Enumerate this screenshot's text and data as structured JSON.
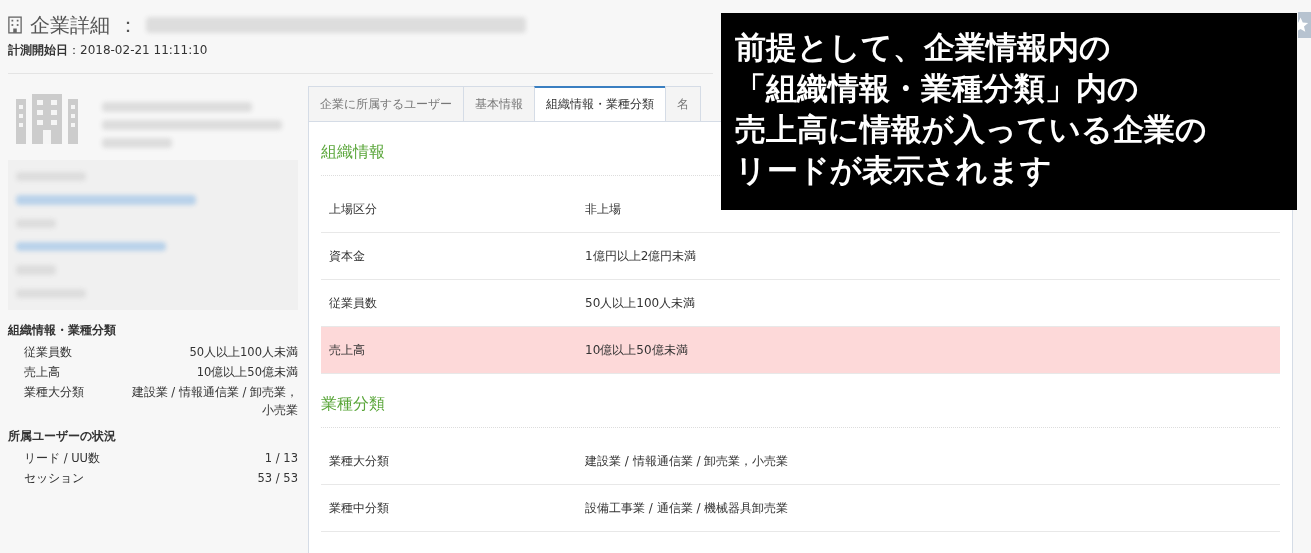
{
  "header": {
    "title": "企業詳細",
    "separator": "：",
    "start_label": "計測開始日",
    "start_value": "：2018-02-21 11:11:10"
  },
  "sidebar": {
    "sections": [
      {
        "title": "組織情報・業種分類",
        "rows": [
          {
            "label": "従業員数",
            "value": "50人以上100人未満"
          },
          {
            "label": "売上高",
            "value": "10億以上50億未満"
          },
          {
            "label": "業種大分類",
            "value": "建設業 / 情報通信業 / 卸売業，小売業"
          }
        ]
      },
      {
        "title": "所属ユーザーの状況",
        "rows": [
          {
            "label": "リード / UU数",
            "value": "1 / 13"
          },
          {
            "label": "セッション",
            "value": "53 / 53"
          }
        ]
      }
    ]
  },
  "tabs": [
    {
      "label": "企業に所属するユーザー",
      "selected": false
    },
    {
      "label": "基本情報",
      "selected": false
    },
    {
      "label": "組織情報・業種分類",
      "selected": true
    },
    {
      "label": "名",
      "selected": false
    }
  ],
  "sections": [
    {
      "title": "組織情報",
      "rows": [
        {
          "label": "上場区分",
          "value": "非上場",
          "highlighted": false
        },
        {
          "label": "資本金",
          "value": "1億円以上2億円未満",
          "highlighted": false
        },
        {
          "label": "従業員数",
          "value": "50人以上100人未満",
          "highlighted": false
        },
        {
          "label": "売上高",
          "value": "10億以上50億未満",
          "highlighted": true
        }
      ]
    },
    {
      "title": "業種分類",
      "rows": [
        {
          "label": "業種大分類",
          "value": "建設業 / 情報通信業 / 卸売業，小売業",
          "highlighted": false
        },
        {
          "label": "業種中分類",
          "value": "設備工事業 / 通信業 / 機械器具卸売業",
          "highlighted": false
        }
      ]
    }
  ],
  "callout": {
    "lines": [
      "前提として、企業情報内の",
      "「組織情報・業種分類」内の",
      "売上高に情報が入っている企業の",
      "リードが表示されます"
    ]
  }
}
